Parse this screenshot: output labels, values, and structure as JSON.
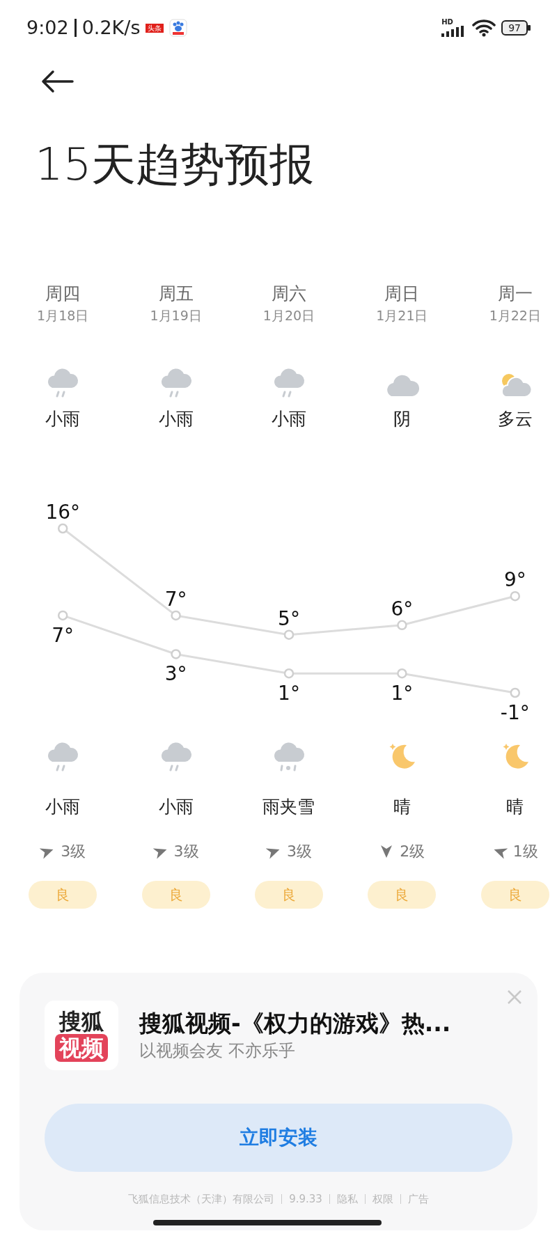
{
  "status_bar": {
    "time": "9:02",
    "speed": "0.2K/s",
    "news_badge": "头条",
    "network_label": "HD",
    "battery": "97"
  },
  "title": "15天趋势预报",
  "days": [
    {
      "weekday": "周四",
      "date": "1月18日",
      "day": {
        "kind": "rain",
        "condition": "小雨"
      },
      "night": {
        "kind": "rain",
        "condition": "小雨"
      },
      "wind": {
        "kind": "ene",
        "level": "3级"
      },
      "aqi": "良"
    },
    {
      "weekday": "周五",
      "date": "1月19日",
      "day": {
        "kind": "rain",
        "condition": "小雨"
      },
      "night": {
        "kind": "rain",
        "condition": "小雨"
      },
      "wind": {
        "kind": "ene",
        "level": "3级"
      },
      "aqi": "良"
    },
    {
      "weekday": "周六",
      "date": "1月20日",
      "day": {
        "kind": "rain",
        "condition": "小雨"
      },
      "night": {
        "kind": "sleet",
        "condition": "雨夹雪"
      },
      "wind": {
        "kind": "ene",
        "level": "3级"
      },
      "aqi": "良"
    },
    {
      "weekday": "周日",
      "date": "1月21日",
      "day": {
        "kind": "overcast",
        "condition": "阴"
      },
      "night": {
        "kind": "clear-night",
        "condition": "晴"
      },
      "wind": {
        "kind": "s",
        "level": "2级"
      },
      "aqi": "良"
    },
    {
      "weekday": "周一",
      "date": "1月22日",
      "day": {
        "kind": "partly-cloudy",
        "condition": "多云"
      },
      "night": {
        "kind": "clear-night",
        "condition": "晴"
      },
      "wind": {
        "kind": "wnw",
        "level": "1级"
      },
      "aqi": "良"
    }
  ],
  "temperature_chart": {
    "chart_data": {
      "type": "line",
      "series": [
        {
          "color": "#dcdcdc",
          "marker": "circle",
          "values": [
            16,
            7,
            5,
            6,
            9
          ],
          "value_labels": [
            "16°",
            "7°",
            "5°",
            "6°",
            "9°"
          ]
        },
        {
          "color": "#dcdcdc",
          "marker": "circle",
          "values": [
            7,
            3,
            1,
            1,
            -1
          ],
          "value_labels": [
            "7°",
            "3°",
            "1°",
            "1°",
            "-1°"
          ]
        }
      ],
      "data_labels": true
    }
  },
  "ad": {
    "logo_top": "搜狐",
    "logo_bottom": "视频",
    "title": "搜狐视频-《权力的游戏》热...",
    "subtitle": "以视频会友 不亦乐乎",
    "button": "立即安装",
    "footer": [
      "飞狐信息技术（天津）有限公司",
      "9.9.33",
      "隐私",
      "权限",
      "广告"
    ]
  }
}
